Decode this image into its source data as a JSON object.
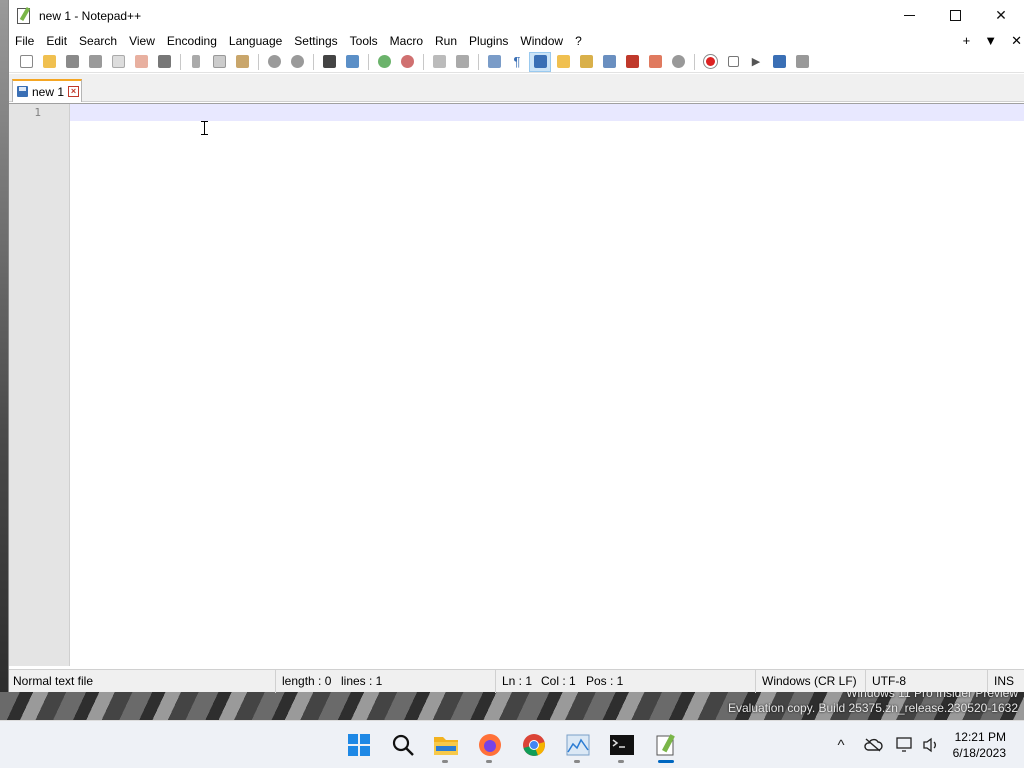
{
  "window": {
    "title": "new 1 - Notepad++",
    "minimize": "—",
    "maximize": "☐",
    "close": "✕"
  },
  "menu": {
    "items": [
      "File",
      "Edit",
      "Search",
      "View",
      "Encoding",
      "Language",
      "Settings",
      "Tools",
      "Macro",
      "Run",
      "Plugins",
      "Window",
      "?"
    ],
    "right": [
      "+",
      "▼",
      "✕"
    ]
  },
  "toolbar": {
    "icons": [
      "new-file-icon",
      "open-file-icon",
      "save-icon",
      "save-all-icon",
      "close-icon",
      "close-all-icon",
      "print-icon",
      "cut-icon",
      "copy-icon",
      "paste-icon",
      "undo-icon",
      "redo-icon",
      "find-icon",
      "replace-icon",
      "zoom-in-icon",
      "zoom-out-icon",
      "sync-vertical-icon",
      "sync-horizontal-icon",
      "word-wrap-icon",
      "show-all-chars-icon",
      "indent-guide-icon",
      "udl-icon",
      "doc-map-icon",
      "doc-list-icon",
      "function-list-icon",
      "folder-workspace-icon",
      "monitoring-icon",
      "record-macro-icon",
      "stop-macro-icon",
      "play-macro-icon",
      "run-macro-multiple-icon",
      "save-macro-icon"
    ]
  },
  "tabs": [
    {
      "label": "new 1"
    }
  ],
  "editor": {
    "line_numbers": [
      "1"
    ]
  },
  "status": {
    "file_type": "Normal text file",
    "length": "length : 0",
    "lines": "lines : 1",
    "ln": "Ln : 1",
    "col": "Col : 1",
    "pos": "Pos : 1",
    "eol": "Windows (CR LF)",
    "encoding": "UTF-8",
    "mode": "INS"
  },
  "desktop": {
    "watermark_line1": "Windows 11 Pro Insider Preview",
    "watermark_line2": "Evaluation copy. Build 25375.zn_release.230520-1632"
  },
  "taskbar": {
    "apps": [
      "start-icon",
      "search-icon",
      "file-explorer-icon",
      "firefox-icon",
      "chrome-icon",
      "resource-monitor-icon",
      "terminal-icon",
      "notepad-plus-plus-icon"
    ],
    "time": "12:21 PM",
    "date": "6/18/2023"
  },
  "colors": {
    "accent": "#0067c0",
    "tab_top": "#f5a623",
    "current_line": "#e8e8ff"
  }
}
